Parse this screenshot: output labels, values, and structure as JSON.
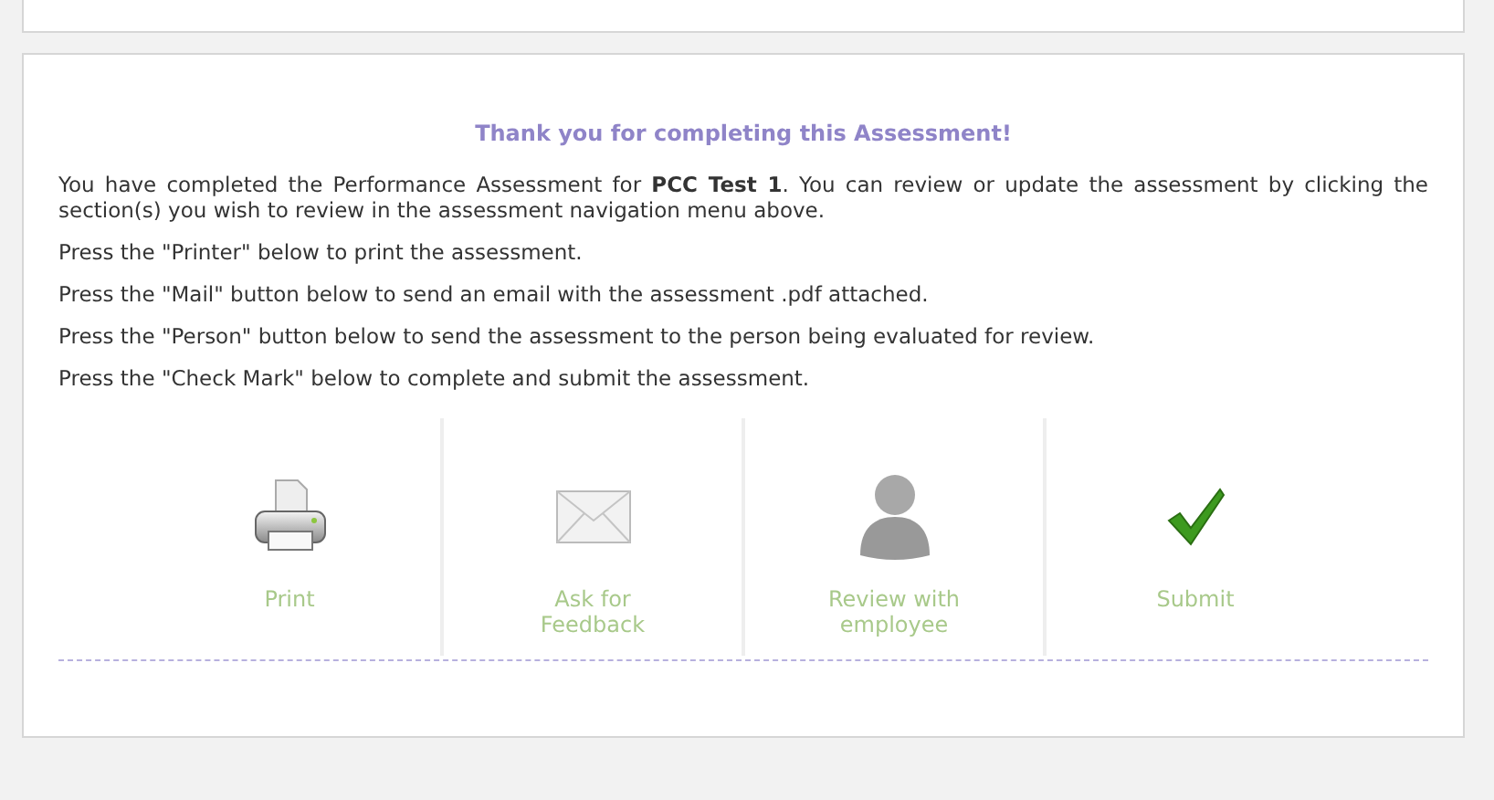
{
  "panel": {
    "title": "Thank you for completing this Assessment!",
    "intro": "You have completed the Performance Assessment for **PCC Test 1**. You can review or update the assessment by clicking the section(s) you wish to review in the assessment navigation menu above.",
    "instructions": [
      "Press the \"Printer\" below to print the assessment.",
      "Press the \"Mail\" button below to send an email with the assessment .pdf attached.",
      "Press the \"Person\" button below to send the assessment to the person being evaluated for review.",
      "Press the \"Check Mark\" below to complete and submit the assessment."
    ],
    "actions": [
      {
        "kind": "print",
        "label": "Print"
      },
      {
        "kind": "mail",
        "label": "Ask for Feedback"
      },
      {
        "kind": "person",
        "label": "Review with employee"
      },
      {
        "kind": "check",
        "label": "Submit"
      }
    ]
  }
}
